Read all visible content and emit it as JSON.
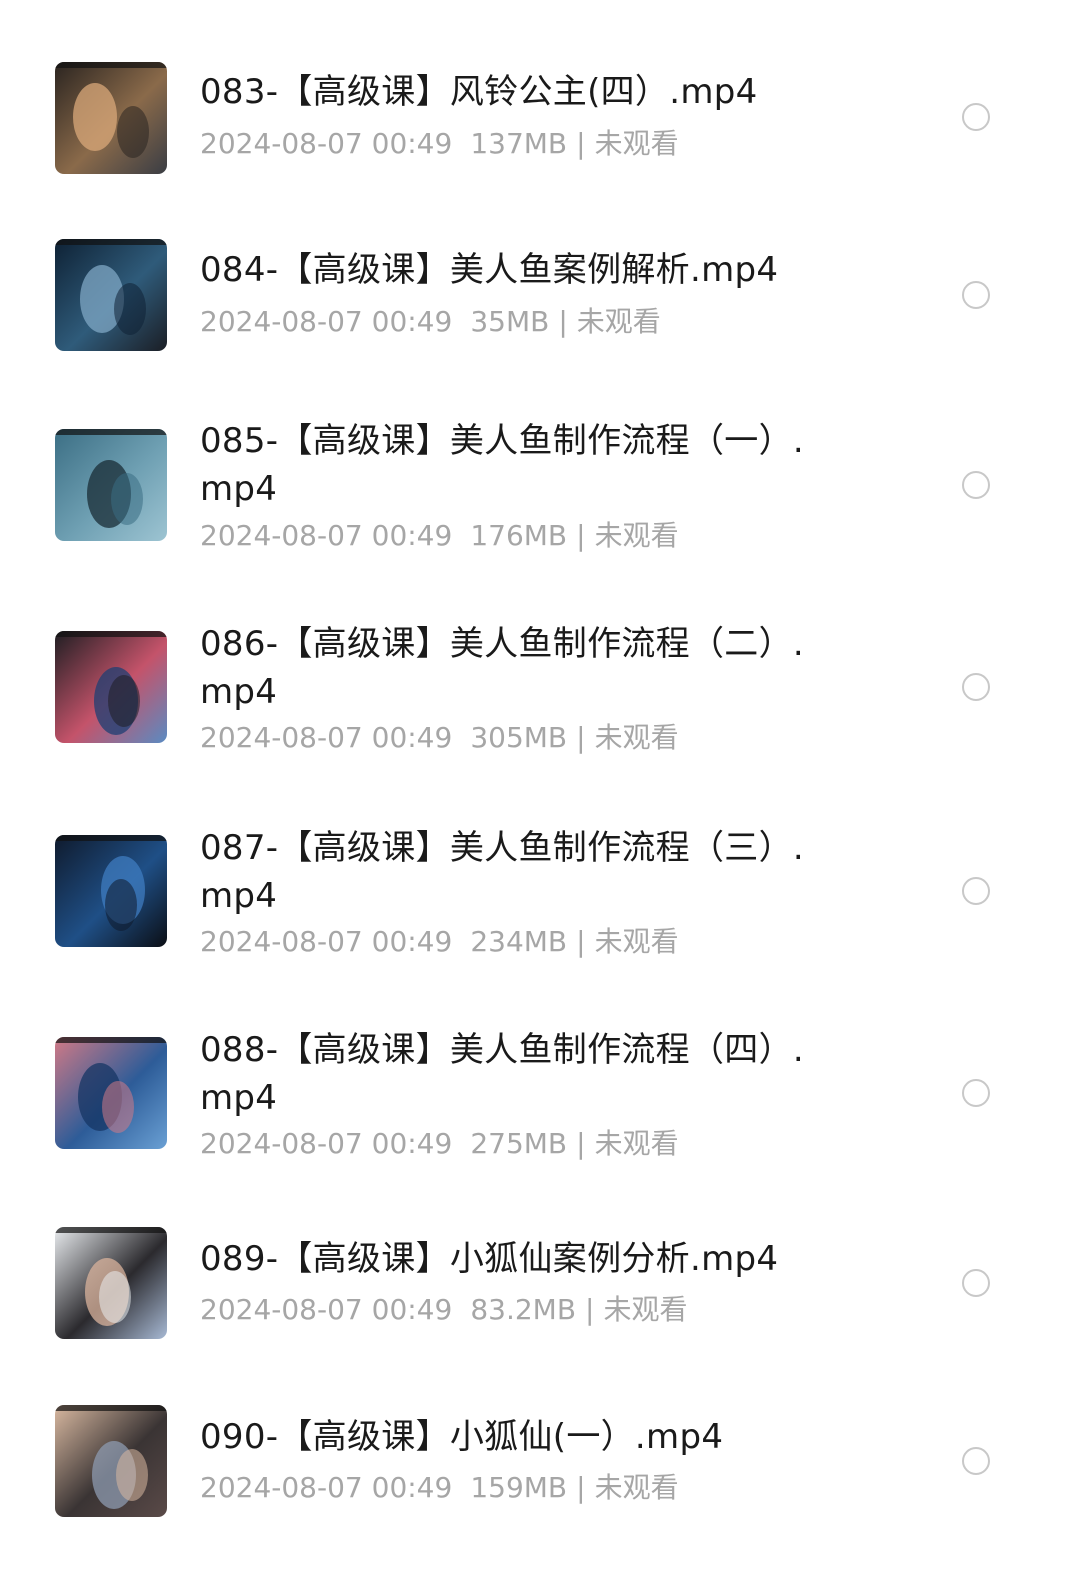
{
  "files": [
    {
      "name": "083-【高级课】风铃公主(四）.mp4",
      "name_line2": "",
      "date": "2024-08-07 00:49",
      "size": "137MB",
      "separator": "|",
      "status": "未观看",
      "thumb_colors": [
        "#2a2420",
        "#8a6a4a",
        "#d9a87a",
        "#3a3d44"
      ]
    },
    {
      "name": "084-【高级课】美人鱼案例解析.mp4",
      "name_line2": "",
      "date": "2024-08-07 00:49",
      "size": "35MB",
      "separator": "|",
      "status": "未观看",
      "thumb_colors": [
        "#0e2134",
        "#2f5b7a",
        "#7fa7c4",
        "#1b1e25"
      ]
    },
    {
      "name": "085-【高级课】美人鱼制作流程（一）.",
      "name_line2": "mp4",
      "date": "2024-08-07 00:49",
      "size": "176MB",
      "separator": "|",
      "status": "未观看",
      "thumb_colors": [
        "#3b6e84",
        "#6fa0b3",
        "#1a2c36",
        "#9dc4d2"
      ]
    },
    {
      "name": "086-【高级课】美人鱼制作流程（二）.",
      "name_line2": "mp4",
      "date": "2024-08-07 00:49",
      "size": "305MB",
      "separator": "|",
      "status": "未观看",
      "thumb_colors": [
        "#1e1e22",
        "#c4536a",
        "#1d3f73",
        "#5a8bc2"
      ]
    },
    {
      "name": "087-【高级课】美人鱼制作流程（三）.",
      "name_line2": "mp4",
      "date": "2024-08-07 00:49",
      "size": "234MB",
      "separator": "|",
      "status": "未观看",
      "thumb_colors": [
        "#0f1a2c",
        "#1f4f86",
        "#3f7cc0",
        "#0b0e14"
      ]
    },
    {
      "name": "088-【高级课】美人鱼制作流程（四）.",
      "name_line2": "mp4",
      "date": "2024-08-07 00:49",
      "size": "275MB",
      "separator": "|",
      "status": "未观看",
      "thumb_colors": [
        "#d27a86",
        "#2d5c98",
        "#163664",
        "#6aa0d4"
      ]
    },
    {
      "name": "089-【高级课】小狐仙案例分析.mp4",
      "name_line2": "",
      "date": "2024-08-07 00:49",
      "size": "83.2MB",
      "separator": "|",
      "status": "未观看",
      "thumb_colors": [
        "#e9ecef",
        "#2b2a2e",
        "#d9b39c",
        "#a7b9d4"
      ]
    },
    {
      "name": "090-【高级课】小狐仙(一）.mp4",
      "name_line2": "",
      "date": "2024-08-07 00:49",
      "size": "159MB",
      "separator": "|",
      "status": "未观看",
      "thumb_colors": [
        "#d8b8a0",
        "#3a3434",
        "#8e9bb0",
        "#5a4a48"
      ]
    }
  ]
}
